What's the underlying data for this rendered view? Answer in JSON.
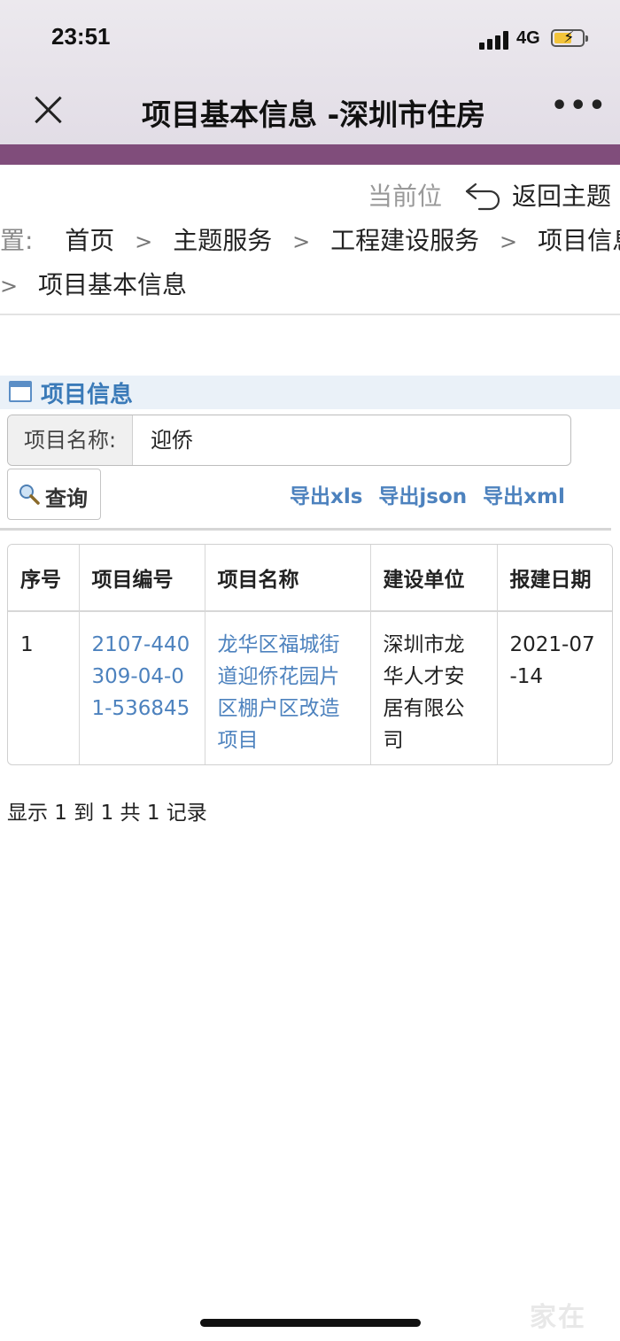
{
  "status_bar": {
    "time": "23:51",
    "network": "4G"
  },
  "nav": {
    "title": "项目基本信息 -深圳市住房"
  },
  "breadcrumb": {
    "current_pos": "当前位",
    "back_label": "返回主题",
    "lead": "置:",
    "items": [
      "首页",
      "主题服务",
      "工程建设服务",
      "项目信息",
      "项目基本信息"
    ],
    "separator": ">"
  },
  "panel": {
    "title": "项目信息",
    "field_label": "项目名称:",
    "field_value": "迎侨",
    "query_label": "查询",
    "exports": [
      "导出xls",
      "导出json",
      "导出xml"
    ]
  },
  "table": {
    "headers": [
      "序号",
      "项目编号",
      "项目名称",
      "建设单位",
      "报建日期"
    ],
    "rows": [
      [
        "1",
        "2107-440309-04-01-536845",
        "龙华区福城街道迎侨花园片区棚户区改造项目",
        "深圳市龙华人才安居有限公司",
        "2021-07-14"
      ]
    ]
  },
  "record_count": "显示 1 到 1 共 1 记录",
  "watermark": "家在"
}
